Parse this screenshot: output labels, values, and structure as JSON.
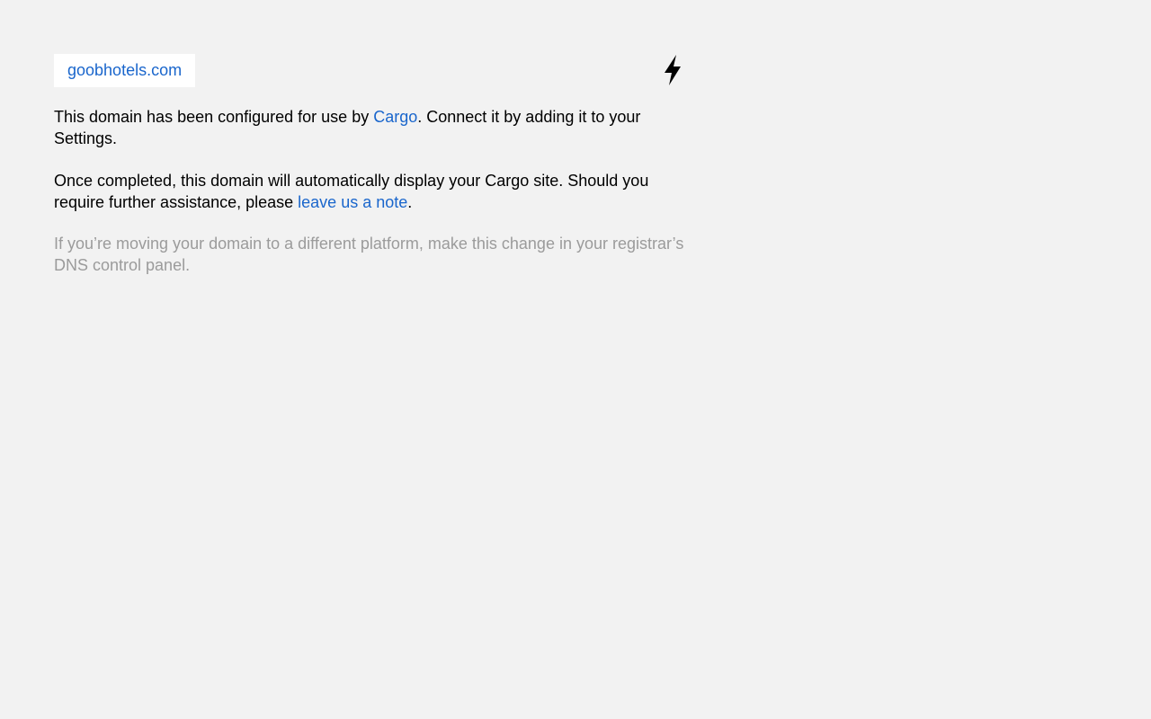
{
  "domain": {
    "name": "goobhotels.com"
  },
  "icon": {
    "name": "lightning-bolt-icon"
  },
  "paragraph1": {
    "before_link": "This domain has been configured for use by ",
    "link_text": "Cargo",
    "after_link": ". Connect it by adding it to your Settings."
  },
  "paragraph2": {
    "before_link": "Once completed, this domain will automatically display your Cargo site. Should you require further assistance, please ",
    "link_text": "leave us a note",
    "after_link": "."
  },
  "paragraph3": {
    "text": "If you’re moving your domain to a different platform, make this change in your registrar’s DNS control panel."
  },
  "colors": {
    "background": "#f2f2f2",
    "link": "#1a66cc",
    "muted_text": "#9b9b9b",
    "domain_box": "#ffffff"
  }
}
